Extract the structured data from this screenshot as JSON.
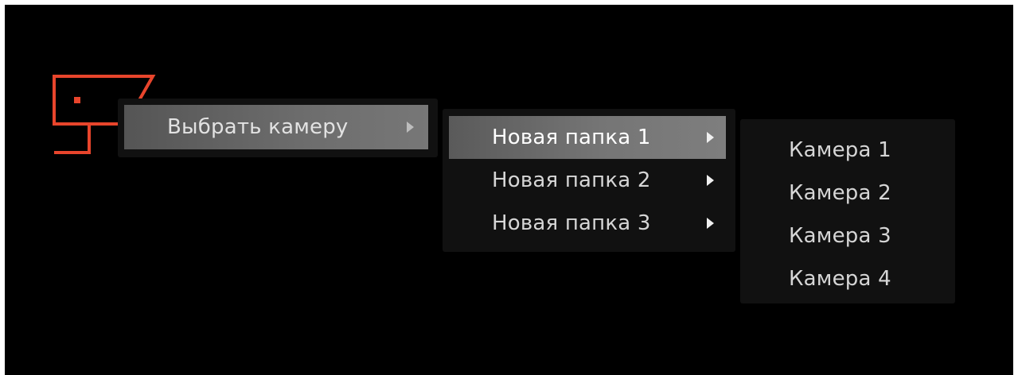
{
  "colors": {
    "background": "#000000",
    "icon_accent": "#e8452c",
    "menu_bg": "#111111",
    "active_item_bg": "#6d6d6d"
  },
  "icon": {
    "name": "security-camera-icon"
  },
  "context_menu": {
    "items": [
      {
        "label": "Выбрать камеру",
        "has_submenu": true,
        "active": true
      }
    ]
  },
  "folders_menu": {
    "items": [
      {
        "label": "Новая папка 1",
        "has_submenu": true,
        "active": true
      },
      {
        "label": "Новая папка 2",
        "has_submenu": true,
        "active": false
      },
      {
        "label": "Новая папка 3",
        "has_submenu": true,
        "active": false
      }
    ]
  },
  "cameras_menu": {
    "items": [
      {
        "label": "Камера 1"
      },
      {
        "label": "Камера 2"
      },
      {
        "label": "Камера 3"
      },
      {
        "label": "Камера 4"
      }
    ]
  }
}
